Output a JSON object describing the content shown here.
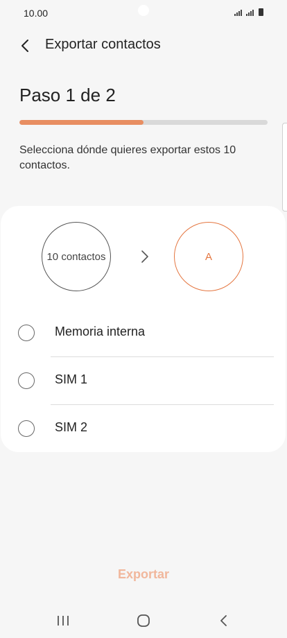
{
  "status_bar": {
    "time": "10.00",
    "icons": [
      "signal-icon",
      "signal-icon",
      "battery-icon"
    ]
  },
  "header": {
    "title": "Exportar contactos",
    "back_icon": "back-arrow-icon"
  },
  "step": {
    "title": "Paso 1 de 2",
    "progress_fraction": 0.5
  },
  "description": "Selecciona dónde quieres exportar estos 10 contactos.",
  "transfer": {
    "source_label": "10 contactos",
    "dest_label": "A",
    "arrow_icon": "chevron-right-icon"
  },
  "options": [
    {
      "label": "Memoria interna",
      "selected": false
    },
    {
      "label": "SIM 1",
      "selected": false
    },
    {
      "label": "SIM 2",
      "selected": false
    }
  ],
  "footer": {
    "export_label": "Exportar"
  },
  "nav_bar": {
    "items": [
      "recent-apps-icon",
      "home-icon",
      "back-icon"
    ]
  },
  "colors": {
    "accent": "#e4753f",
    "progress": "#e88e62",
    "export_disabled": "#f1b79c",
    "background": "#f6f6f6"
  }
}
